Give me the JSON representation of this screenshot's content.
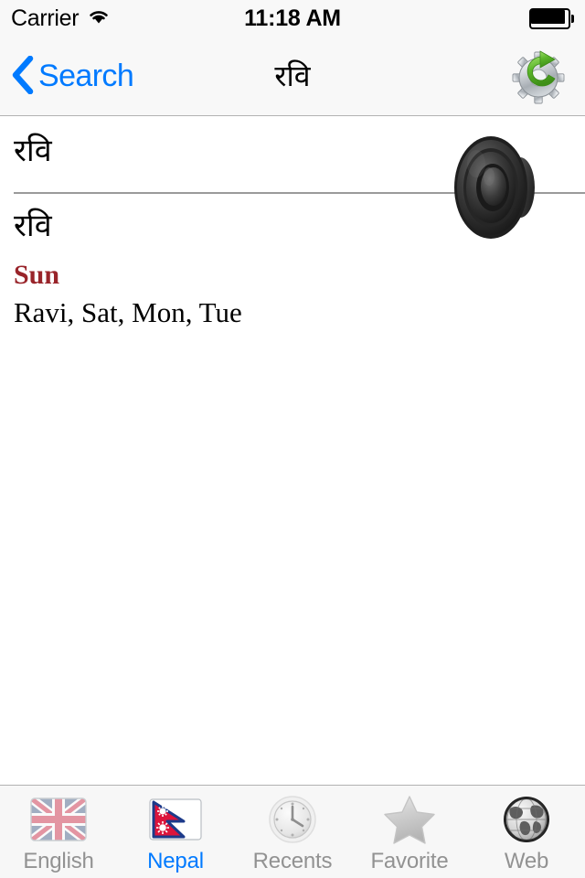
{
  "status_bar": {
    "carrier": "Carrier",
    "wifi_icon": "wifi-icon",
    "time": "11:18 AM",
    "battery_icon": "battery-full-icon"
  },
  "nav_bar": {
    "back_icon": "chevron-left-icon",
    "back_label": "Search",
    "title": "रवि",
    "action_icon": "gear-refresh-icon"
  },
  "entry": {
    "headword_primary": "रवि",
    "headword_secondary": "रवि",
    "gloss_head": "Sun",
    "gloss_body": "Ravi, Sat, Mon, Tue",
    "speaker_icon": "speaker-icon"
  },
  "tab_bar": {
    "items": [
      {
        "label": "English",
        "icon": "uk-flag-icon",
        "active": false
      },
      {
        "label": "Nepal",
        "icon": "nepal-flag-icon",
        "active": true
      },
      {
        "label": "Recents",
        "icon": "clock-icon",
        "active": false
      },
      {
        "label": "Favorite",
        "icon": "star-icon",
        "active": false
      },
      {
        "label": "Web",
        "icon": "globe-icon",
        "active": false
      }
    ]
  },
  "colors": {
    "accent_blue": "#007aff",
    "gloss_red": "#99242a",
    "inactive_gray": "#929292",
    "bar_background": "#f7f7f7",
    "divider": "#9a9a9a"
  }
}
